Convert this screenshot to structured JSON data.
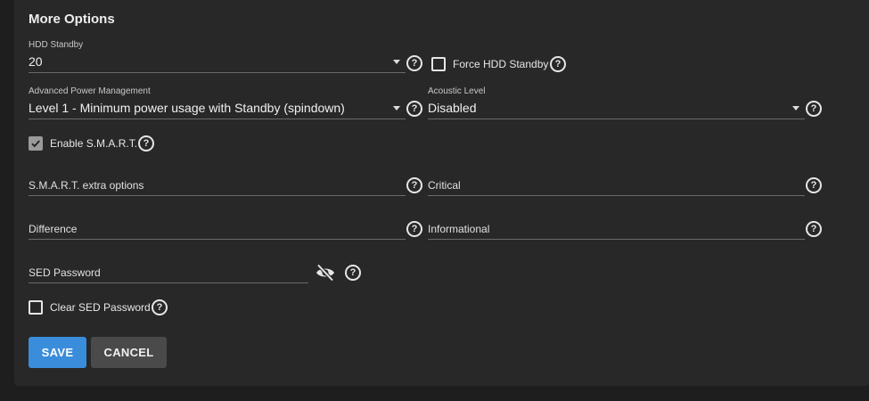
{
  "section": {
    "title": "More Options"
  },
  "hdd_standby": {
    "label": "HDD Standby",
    "value": "20"
  },
  "force_hdd_standby": {
    "label": "Force HDD Standby",
    "checked": false
  },
  "advanced_power_management": {
    "label": "Advanced Power Management",
    "value": "Level 1 - Minimum power usage with Standby (spindown)"
  },
  "acoustic_level": {
    "label": "Acoustic Level",
    "value": "Disabled"
  },
  "enable_smart": {
    "label": "Enable S.M.A.R.T.",
    "checked": true
  },
  "smart_extra_options": {
    "placeholder": "S.M.A.R.T. extra options"
  },
  "critical": {
    "placeholder": "Critical"
  },
  "difference": {
    "placeholder": "Difference"
  },
  "informational": {
    "placeholder": "Informational"
  },
  "sed_password": {
    "placeholder": "SED Password"
  },
  "clear_sed_password": {
    "label": "Clear SED Password",
    "checked": false
  },
  "buttons": {
    "save": "SAVE",
    "cancel": "CANCEL"
  },
  "icons": {
    "help": "help-circle-icon",
    "visibility": "eye-off-icon",
    "dropdown": "caret-down-icon",
    "check": "check-icon"
  },
  "colors": {
    "accent": "#3a8ddb",
    "card": "#282828",
    "background": "#1e1e1e"
  }
}
